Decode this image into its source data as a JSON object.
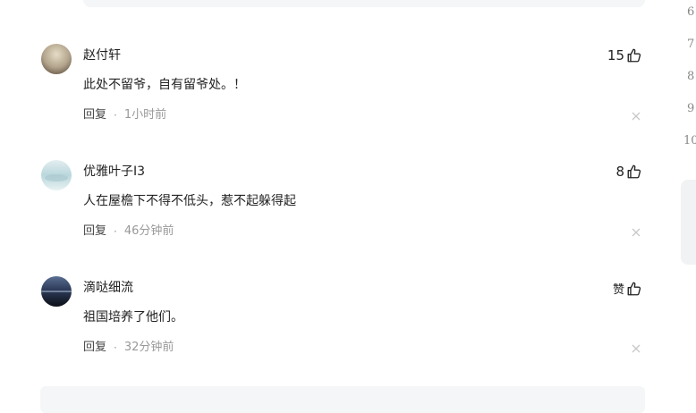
{
  "comments": [
    {
      "username": "赵付轩",
      "content": "此处不留爷，自有留爷处。！",
      "reply_label": "回复",
      "time": "1小时前",
      "likes": "15",
      "avatar_colors": [
        "#d8cdb8",
        "#7a6a58"
      ]
    },
    {
      "username": "优雅叶子I3",
      "content": "人在屋檐下不得不低头，惹不起躲得起",
      "reply_label": "回复",
      "time": "46分钟前",
      "likes": "8",
      "avatar_colors": [
        "#cfe3e6",
        "#8fb9c2"
      ]
    },
    {
      "username": "滴哒细流",
      "content": "祖国培养了他们。",
      "reply_label": "回复",
      "time": "32分钟前",
      "likes": "赞",
      "avatar_colors": [
        "#3b4a6b",
        "#0f1420"
      ]
    }
  ],
  "sidebar_numbers": [
    "6",
    "7",
    "8",
    "9",
    "10"
  ],
  "icons": {
    "like": "thumbs-up-icon",
    "close": "close-icon"
  },
  "colors": {
    "text": "#222222",
    "muted": "#999999",
    "panel": "#f5f6f7"
  }
}
